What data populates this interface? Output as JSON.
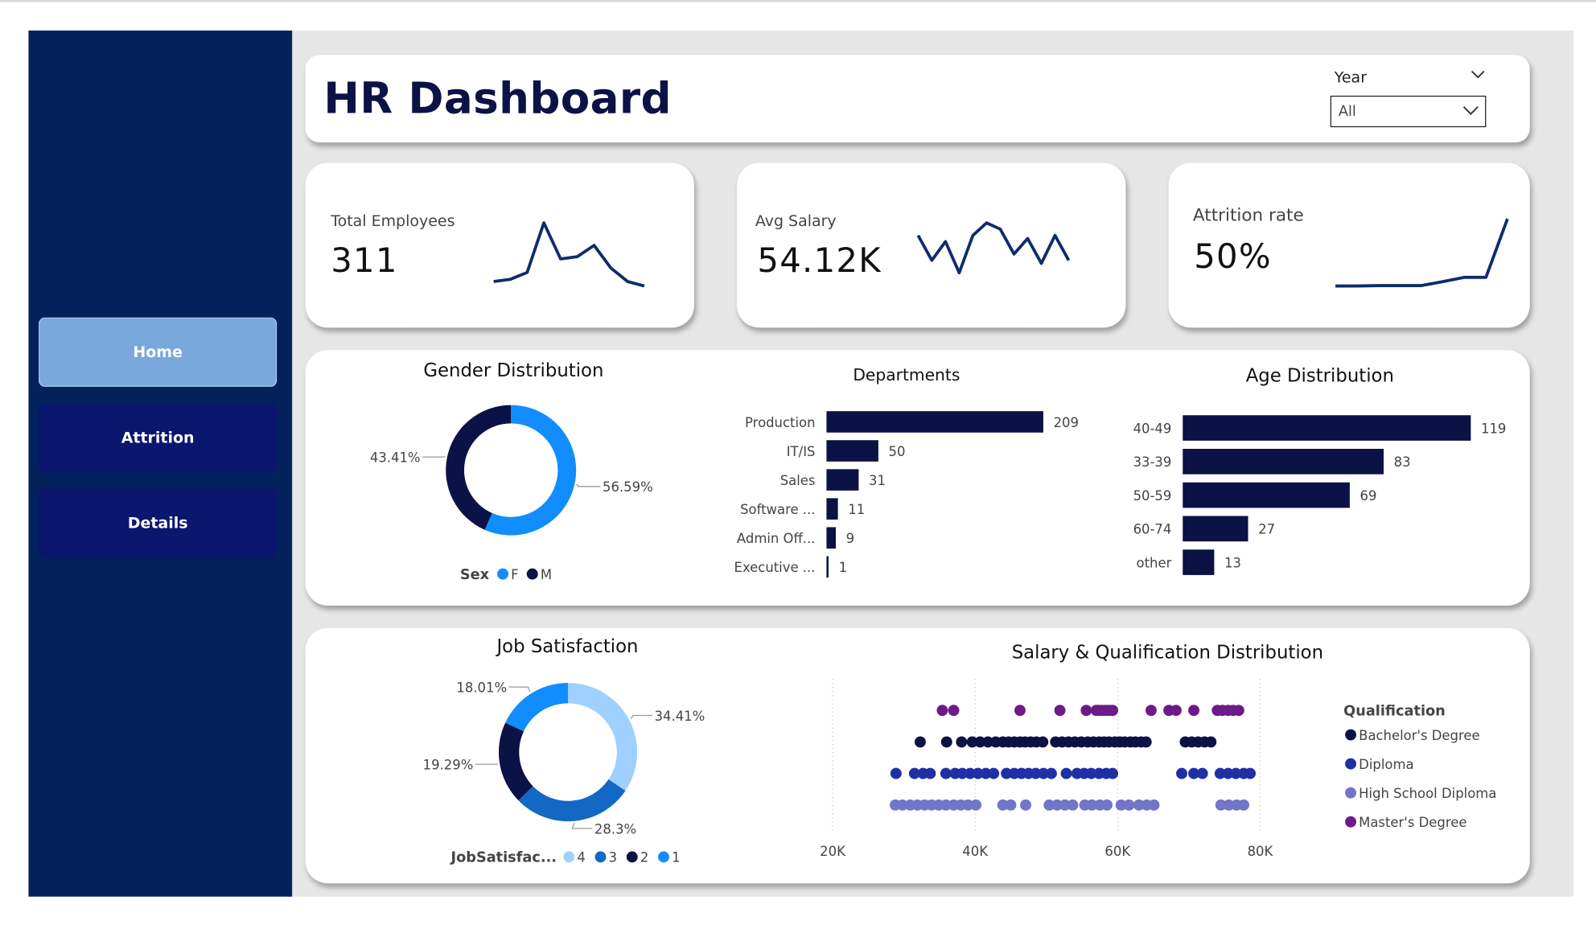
{
  "sidebar": {
    "nav": [
      {
        "label": "Home"
      },
      {
        "label": "Attrition"
      },
      {
        "label": "Details"
      }
    ]
  },
  "header": {
    "title": "HR Dashboard",
    "year_filter": {
      "label": "Year",
      "value": "All"
    }
  },
  "kpis": [
    {
      "label": "Total Employees",
      "value": "311",
      "trend": [
        2,
        2.5,
        4,
        15,
        7,
        7.5,
        10,
        5,
        2,
        1
      ],
      "color": "#0d2d6c"
    },
    {
      "label": "Avg Salary",
      "value": "54.12K",
      "trend": [
        7,
        3,
        6,
        1,
        7,
        9,
        8,
        4,
        6.5,
        2.5,
        7,
        3
      ],
      "color": "#0d2d6c"
    },
    {
      "label": "Attrition rate",
      "value": "50%",
      "trend": [
        0.5,
        0.5,
        0.6,
        0.6,
        0.6,
        1.5,
        2.5,
        2.5,
        16
      ],
      "color": "#0d2d6c"
    }
  ],
  "colors": {
    "navy": "#0b1245",
    "blue": "#118dff",
    "sidebar": "#03215b",
    "nav_active": "#7aa7dc",
    "nav_inactive": "#0b166f"
  },
  "chart_data": [
    {
      "type": "pie",
      "title": "Gender Distribution",
      "legend_title": "Sex",
      "legend_position": "bottom",
      "slices": [
        {
          "name": "F",
          "value": 56.59,
          "label": "56.59%",
          "color": "#118dff"
        },
        {
          "name": "M",
          "value": 43.41,
          "label": "43.41%",
          "color": "#0b1245"
        }
      ]
    },
    {
      "type": "bar",
      "orientation": "horizontal",
      "title": "Departments",
      "categories": [
        "Production",
        "IT/IS",
        "Sales",
        "Software ...",
        "Admin Off...",
        "Executive ..."
      ],
      "values": [
        209,
        50,
        31,
        11,
        9,
        1
      ],
      "color": "#0b1245"
    },
    {
      "type": "bar",
      "orientation": "horizontal",
      "title": "Age Distribution",
      "categories": [
        "40-49",
        "33-39",
        "50-59",
        "60-74",
        "other"
      ],
      "values": [
        119,
        83,
        69,
        27,
        13
      ],
      "color": "#0b1245"
    },
    {
      "type": "pie",
      "title": "Job Satisfaction",
      "legend_title": "JobSatisfac...",
      "legend_position": "bottom",
      "slices": [
        {
          "name": "4",
          "value": 34.41,
          "label": "34.41%",
          "color": "#9fd0ff"
        },
        {
          "name": "3",
          "value": 28.3,
          "label": "28.3%",
          "color": "#1268c4"
        },
        {
          "name": "2",
          "value": 19.29,
          "label": "19.29%",
          "color": "#0b1245"
        },
        {
          "name": "1",
          "value": 18.01,
          "label": "18.01%",
          "color": "#118dff"
        }
      ]
    },
    {
      "type": "scatter",
      "title": "Salary & Qualification Distribution",
      "xlim": [
        20000,
        85000
      ],
      "x_ticks": [
        {
          "value": 20000,
          "label": "20K"
        },
        {
          "value": 40000,
          "label": "40K"
        },
        {
          "value": 60000,
          "label": "60K"
        },
        {
          "value": 80000,
          "label": "80K"
        }
      ],
      "legend_title": "Qualification",
      "legend_position": "right",
      "series": [
        {
          "name": "Master's Degree",
          "color": "#6e1a87",
          "x": [
            35400,
            37000,
            46300,
            51900,
            55600,
            57000,
            57300,
            57800,
            58300,
            58800,
            59300,
            64700,
            67200,
            68200,
            70700,
            74000,
            74700,
            75500,
            76200,
            77000
          ]
        },
        {
          "name": "Bachelor's Degree",
          "color": "#0b1245",
          "x": [
            32300,
            36000,
            38100,
            39600,
            40700,
            41800,
            42900,
            43900,
            44700,
            45500,
            46300,
            47000,
            47800,
            48600,
            49500,
            51300,
            52200,
            53100,
            54000,
            54900,
            55800,
            56600,
            57400,
            58100,
            58800,
            59600,
            60300,
            61000,
            61800,
            62500,
            63300,
            64000,
            69500,
            70400,
            71300,
            72200,
            73100
          ]
        },
        {
          "name": "Diploma",
          "color": "#1f2fa6",
          "x": [
            28900,
            31500,
            32700,
            33700,
            35900,
            37200,
            38200,
            39300,
            40400,
            41500,
            42600,
            44400,
            45500,
            46500,
            47500,
            48500,
            49600,
            50700,
            52800,
            54300,
            55300,
            56300,
            57400,
            58400,
            59300,
            69000,
            70700,
            71900,
            74400,
            75500,
            76600,
            77700,
            78600
          ]
        },
        {
          "name": "High School Diploma",
          "color": "#7176c8",
          "x": [
            28800,
            29800,
            30900,
            31900,
            32900,
            33900,
            34900,
            35900,
            37000,
            38000,
            39000,
            40100,
            43900,
            45000,
            47100,
            50400,
            51500,
            52600,
            53700,
            55400,
            56400,
            57500,
            58500,
            60500,
            61600,
            63000,
            64100,
            65100,
            74500,
            75600,
            76700,
            77700
          ]
        }
      ]
    }
  ]
}
